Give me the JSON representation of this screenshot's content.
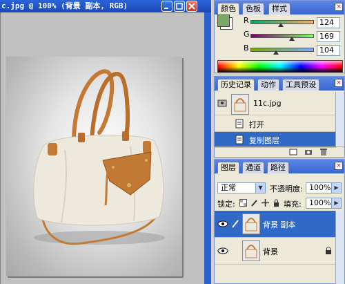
{
  "document": {
    "title": "c.jpg @ 100% (背景 副本, RGB)"
  },
  "color_panel": {
    "tabs": [
      "颜色",
      "色板",
      "样式"
    ],
    "channels": [
      {
        "label": "R",
        "value": "124",
        "level": 0.486
      },
      {
        "label": "G",
        "value": "169",
        "level": 0.663
      },
      {
        "label": "B",
        "value": "104",
        "level": 0.408
      }
    ],
    "foreground_color": "#7ca968",
    "background_color": "#ffffff"
  },
  "history_panel": {
    "tabs": [
      "历史记录",
      "动作",
      "工具预设"
    ],
    "snapshot": "11c.jpg",
    "steps": [
      {
        "label": "打开",
        "selected": false
      },
      {
        "label": "复制图层",
        "selected": true
      }
    ]
  },
  "layers_panel": {
    "tabs": [
      "图层",
      "通道",
      "路径"
    ],
    "blend_mode": "正常",
    "opacity_label": "不透明度:",
    "opacity_value": "100%",
    "lock_label": "锁定:",
    "fill_label": "填充:",
    "fill_value": "100%",
    "layers": [
      {
        "name": "背景 副本",
        "selected": true,
        "locked": false
      },
      {
        "name": "背景",
        "selected": false,
        "locked": true
      }
    ]
  }
}
